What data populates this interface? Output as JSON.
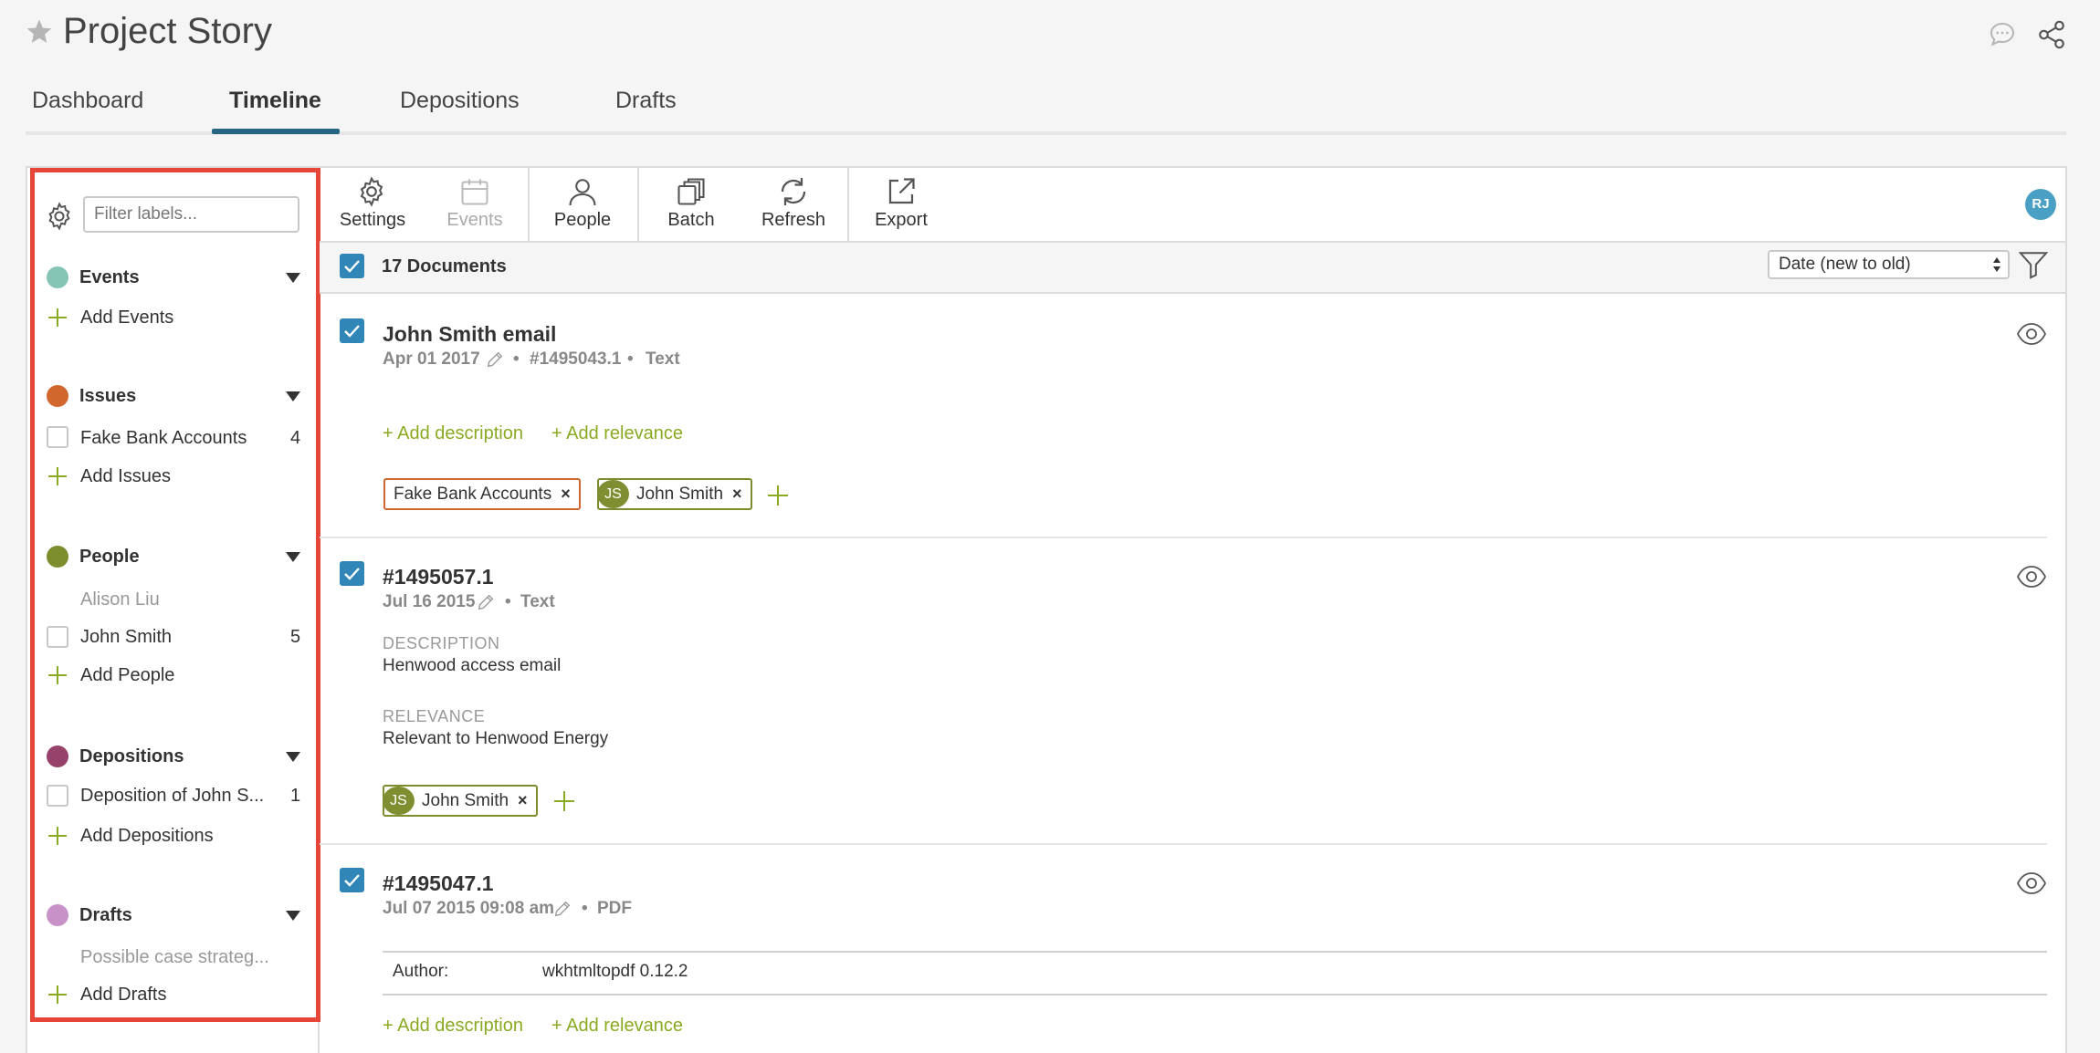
{
  "header": {
    "title": "Project Story"
  },
  "tabs": [
    {
      "label": "Dashboard"
    },
    {
      "label": "Timeline"
    },
    {
      "label": "Depositions"
    },
    {
      "label": "Drafts"
    }
  ],
  "sidebar": {
    "filter_placeholder": "Filter labels...",
    "sections": [
      {
        "title": "Events",
        "color": "#84c4b4",
        "add_label": "Add Events"
      },
      {
        "title": "Issues",
        "color": "#d2672d",
        "add_label": "Add Issues",
        "items": [
          {
            "label": "Fake Bank Accounts",
            "count": "4"
          }
        ]
      },
      {
        "title": "People",
        "color": "#7b8d2c",
        "add_label": "Add People",
        "muted": "Alison Liu",
        "items": [
          {
            "label": "John Smith",
            "count": "5"
          }
        ]
      },
      {
        "title": "Depositions",
        "color": "#96426a",
        "add_label": "Add Depositions",
        "items": [
          {
            "label": "Deposition of John S...",
            "count": "1"
          }
        ]
      },
      {
        "title": "Drafts",
        "color": "#c892c8",
        "add_label": "Add Drafts",
        "muted": "Possible case strateg..."
      }
    ]
  },
  "toolbar": {
    "settings": "Settings",
    "events": "Events",
    "people": "People",
    "batch": "Batch",
    "refresh": "Refresh",
    "export": "Export",
    "avatar": "RJ"
  },
  "list": {
    "count_label": "17 Documents",
    "sort_value": "Date (new to old)"
  },
  "documents": [
    {
      "title": "John Smith email",
      "date": "Apr 01 2017",
      "id": "#1495043.1",
      "type": "Text",
      "add_description": "+ Add description",
      "add_relevance": "+ Add relevance",
      "issue_tag": "Fake Bank Accounts",
      "person_initials": "JS",
      "person_tag": "John Smith"
    },
    {
      "title": "#1495057.1",
      "date": "Jul 16 2015",
      "type": "Text",
      "description_label": "DESCRIPTION",
      "description": "Henwood access email",
      "relevance_label": "RELEVANCE",
      "relevance": "Relevant to Henwood Energy",
      "person_initials": "JS",
      "person_tag": "John Smith"
    },
    {
      "title": "#1495047.1",
      "date": "Jul 07 2015 09:08 am",
      "type": "PDF",
      "author_label": "Author:",
      "author_value": "wkhtmltopdf 0.12.2",
      "add_description": "+ Add description",
      "add_relevance": "+ Add relevance"
    }
  ],
  "colors": {
    "accent": "#276582",
    "link_green": "#8aaa22",
    "checkbox_blue": "#2f86b7",
    "highlight_red": "#e6463a"
  }
}
